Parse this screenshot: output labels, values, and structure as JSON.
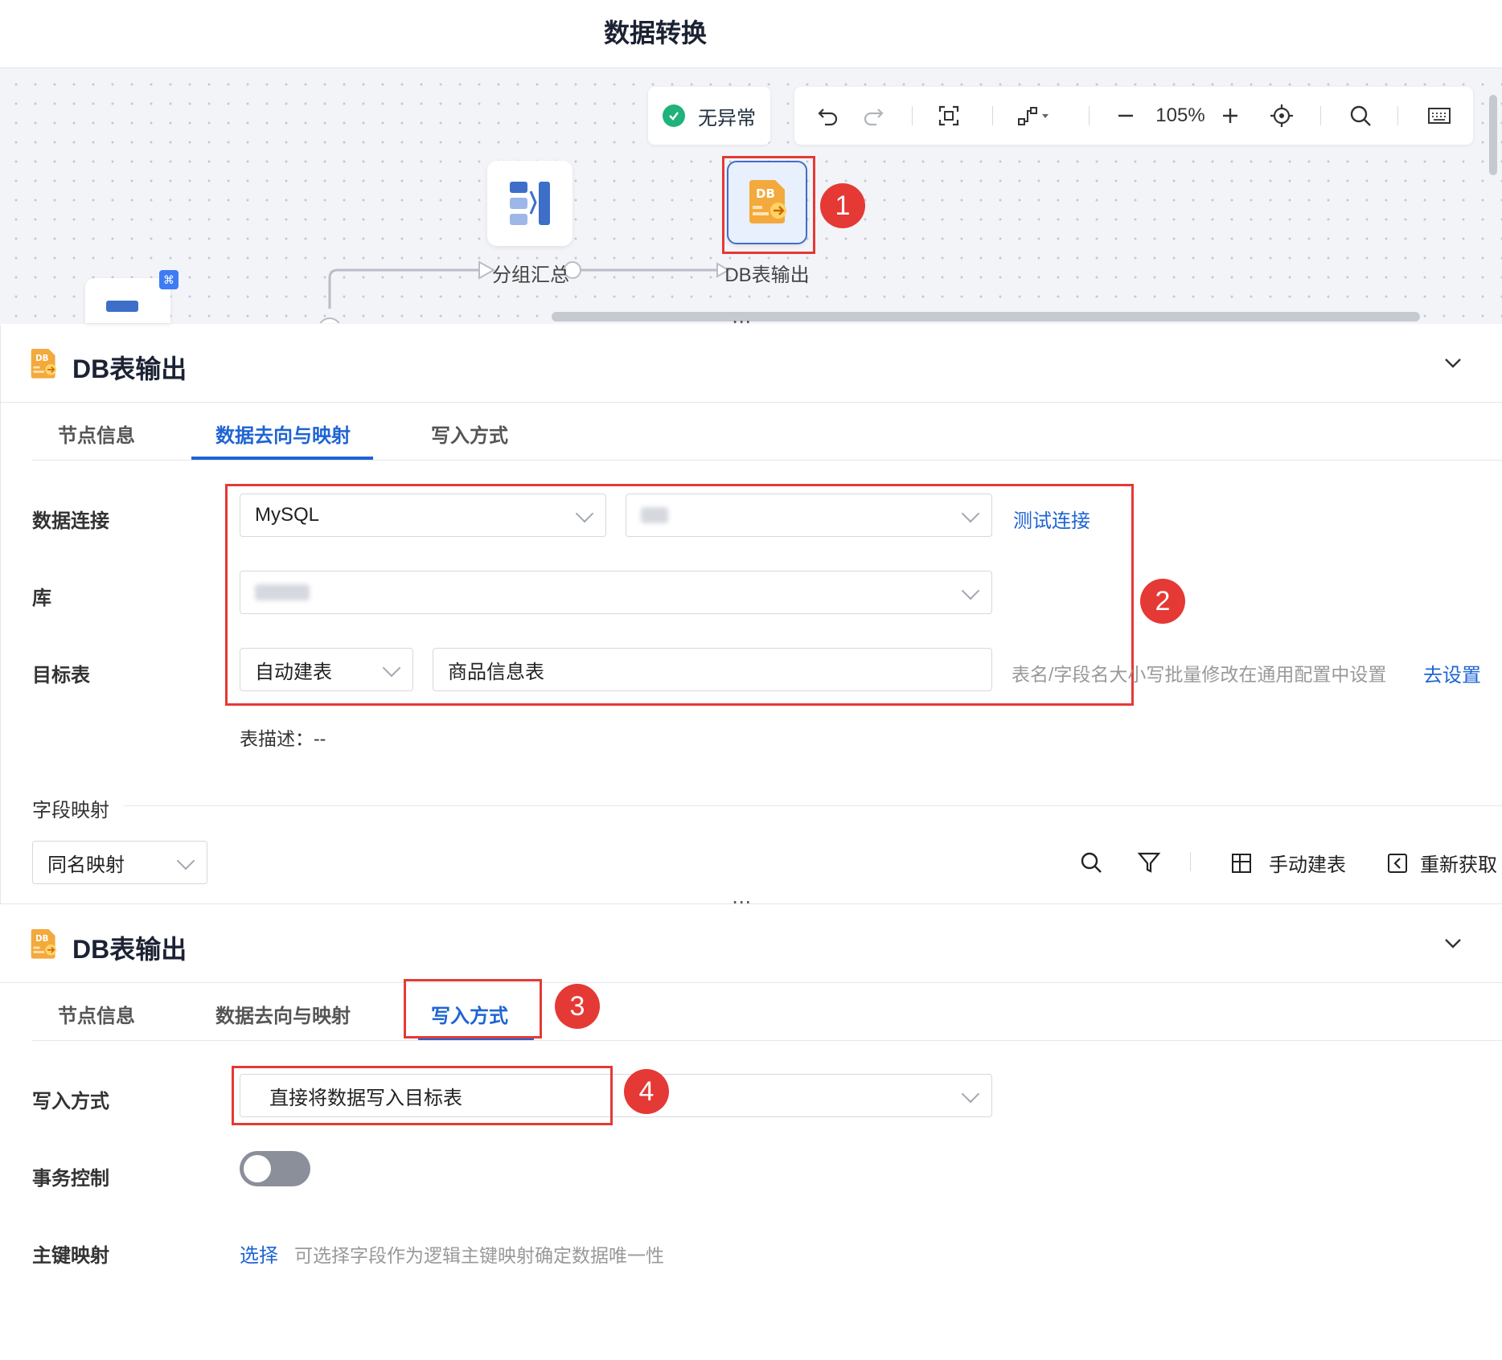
{
  "page_title": "数据转换",
  "canvas": {
    "status_text": "无异常",
    "zoom": "105%",
    "nodes": [
      {
        "label": "分组汇总"
      },
      {
        "label": "DB表输出"
      }
    ]
  },
  "callouts": [
    "1",
    "2",
    "3",
    "4"
  ],
  "panel1": {
    "title": "DB表输出",
    "tabs": [
      "节点信息",
      "数据去向与映射",
      "写入方式"
    ],
    "active_tab": 1,
    "data_connection_label": "数据连接",
    "db_type": "MySQL",
    "test_connection": "测试连接",
    "library_label": "库",
    "target_table_label": "目标表",
    "table_mode": "自动建表",
    "table_name": "商品信息表",
    "case_hint": "表名/字段名大小写批量修改在通用配置中设置",
    "go_settings": "去设置",
    "table_desc": "表描述：--",
    "field_mapping_label": "字段映射",
    "mapping_mode": "同名映射",
    "manual_create": "手动建表",
    "refetch": "重新获取"
  },
  "panel2": {
    "title": "DB表输出",
    "tabs": [
      "节点信息",
      "数据去向与映射",
      "写入方式"
    ],
    "active_tab": 2,
    "write_mode_label": "写入方式",
    "write_mode_value": "直接将数据写入目标表",
    "transaction_label": "事务控制",
    "transaction_on": false,
    "pk_label": "主键映射",
    "pk_select": "选择",
    "pk_hint": "可选择字段作为逻辑主键映射确定数据唯一性"
  },
  "colors": {
    "accent": "#1e64d3",
    "callout": "#e53935",
    "status_ok": "#1fb27a"
  }
}
